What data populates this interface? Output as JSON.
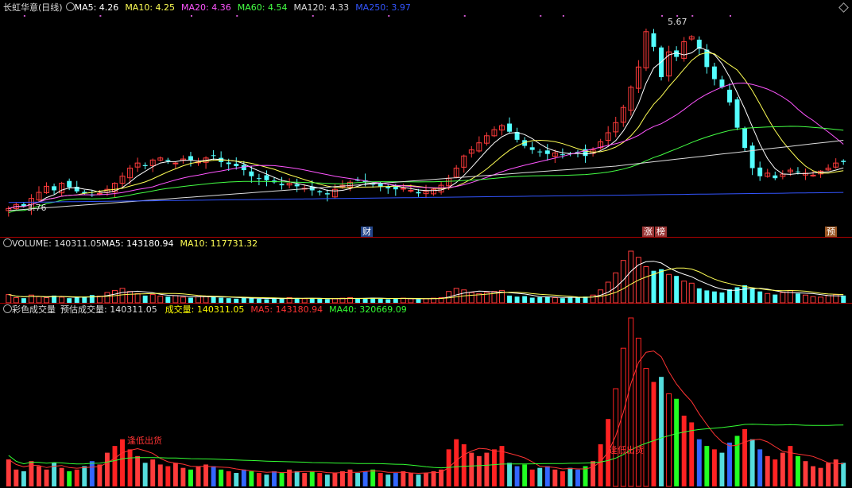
{
  "main_panel": {
    "title": "长虹华意(日线)",
    "legend": [
      {
        "label": "MA5: 4.26",
        "color": "#ffffff"
      },
      {
        "label": "MA10: 4.25",
        "color": "#ffff55"
      },
      {
        "label": "MA20: 4.36",
        "color": "#ff55ff"
      },
      {
        "label": "MA60: 4.54",
        "color": "#44ff44"
      },
      {
        "label": "MA120: 4.33",
        "color": "#dddddd"
      },
      {
        "label": "MA250: 3.97",
        "color": "#3355ff"
      }
    ],
    "high_label": "5.67",
    "low_label": "3.76",
    "markers": [
      {
        "text": "财",
        "bg": "#3366cc"
      },
      {
        "text": "涨",
        "bg": "#aa4444"
      },
      {
        "text": "榜",
        "bg": "#aa4444"
      },
      {
        "text": "预",
        "bg": "#aa6622"
      }
    ]
  },
  "volume_panel": {
    "title": "VOLUME: 140311.05",
    "legend": [
      {
        "label": "MA5: 143180.94",
        "color": "#ffffff"
      },
      {
        "label": "MA10: 117731.32",
        "color": "#ffff55"
      }
    ]
  },
  "color_volume_panel": {
    "title": "彩色成交量",
    "estimate": "预估成交量: 140311.05",
    "legend": [
      {
        "label": "成交量: 140311.05",
        "color": "#ffff00"
      },
      {
        "label": "MA5: 143180.94",
        "color": "#ff3333"
      },
      {
        "label": "MA40: 320669.09",
        "color": "#33ff33"
      }
    ],
    "annotation": "逢低出货"
  },
  "chart_data": {
    "type": "candlestick",
    "price_range": [
      3.76,
      5.67
    ],
    "bars": 120,
    "close_series": [
      3.8,
      3.84,
      3.82,
      3.9,
      3.96,
      4.02,
      3.98,
      4.05,
      4.01,
      3.97,
      3.95,
      3.93,
      3.95,
      3.99,
      4.05,
      4.12,
      4.2,
      4.25,
      4.22,
      4.28,
      4.3,
      4.27,
      4.25,
      4.29,
      4.28,
      4.26,
      4.3,
      4.32,
      4.26,
      4.24,
      4.22,
      4.18,
      4.12,
      4.1,
      4.08,
      4.06,
      4.03,
      4.05,
      4.02,
      4.0,
      3.98,
      3.96,
      3.94,
      3.99,
      4.03,
      4.06,
      4.08,
      4.06,
      4.04,
      4.02,
      4.0,
      3.99,
      4.0,
      3.98,
      3.95,
      3.97,
      3.99,
      4.03,
      4.1,
      4.2,
      4.32,
      4.38,
      4.45,
      4.52,
      4.58,
      4.62,
      4.56,
      4.48,
      4.42,
      4.38,
      4.36,
      4.34,
      4.35,
      4.33,
      4.34,
      4.36,
      4.32,
      4.38,
      4.46,
      4.55,
      4.65,
      4.8,
      5.0,
      5.2,
      5.55,
      5.4,
      5.1,
      5.35,
      5.3,
      5.45,
      5.5,
      5.38,
      5.2,
      5.08,
      5.0,
      4.85,
      4.6,
      4.4,
      4.2,
      4.12,
      4.15,
      4.1,
      4.14,
      4.18,
      4.16,
      4.15,
      4.13,
      4.17,
      4.2,
      4.25,
      4.26
    ],
    "volume_series": [
      16,
      10,
      9,
      15,
      12,
      10,
      14,
      11,
      9,
      10,
      12,
      15,
      13,
      20,
      24,
      28,
      22,
      18,
      14,
      16,
      13,
      12,
      14,
      11,
      10,
      12,
      13,
      12,
      10,
      9,
      8,
      10,
      9,
      8,
      7,
      9,
      8,
      10,
      9,
      8,
      9,
      8,
      7,
      8,
      9,
      10,
      8,
      9,
      10,
      8,
      7,
      8,
      9,
      8,
      7,
      8,
      9,
      10,
      22,
      28,
      25,
      20,
      18,
      20,
      22,
      24,
      14,
      12,
      13,
      10,
      11,
      12,
      10,
      9,
      11,
      10,
      12,
      15,
      25,
      40,
      58,
      82,
      100,
      88,
      70,
      62,
      65,
      55,
      52,
      42,
      38,
      28,
      24,
      22,
      20,
      26,
      30,
      34,
      28,
      22,
      18,
      16,
      20,
      24,
      18,
      15,
      12,
      11,
      14,
      16,
      14
    ],
    "volume_labels": {
      "VOLUME": 140311.05,
      "MA5": 143180.94,
      "MA10": 117731.32,
      "MA40": 320669.09
    }
  }
}
